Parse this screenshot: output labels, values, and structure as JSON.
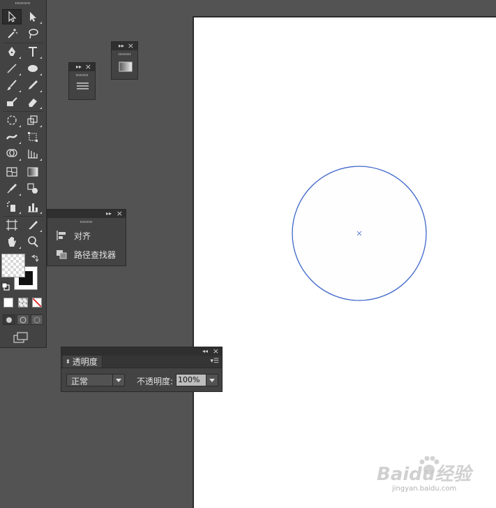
{
  "panels": {
    "align_label": "对齐",
    "pathfinder_label": "路径查找器"
  },
  "transparency": {
    "tab_label": "透明度",
    "blend_mode": "正常",
    "opacity_label": "不透明度:",
    "opacity_value": "100%"
  },
  "watermark": {
    "brand": "Baidu经验",
    "url": "jingyan.baidu.com"
  },
  "colors": {
    "workspace": "#535353",
    "panel": "#434343",
    "artboard": "#ffffff",
    "circle_stroke": "#3d66c9",
    "stroke_swatch": "#111111"
  }
}
